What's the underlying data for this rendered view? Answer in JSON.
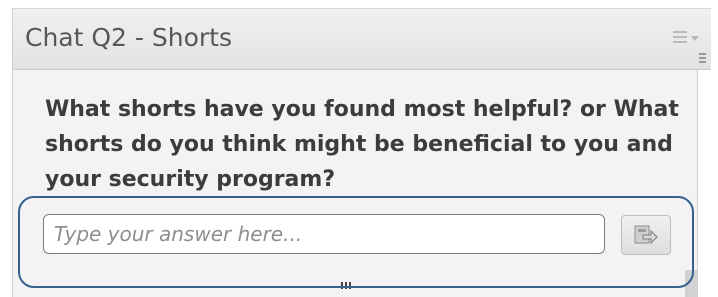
{
  "pod": {
    "title": "Chat Q2 - Shorts",
    "menu_icon": "hamburger-menu-icon",
    "question": "What shorts have you found most helpful? or What shorts do you think might be beneficial to you and your security program?",
    "answer": {
      "value": "",
      "placeholder": "Type your answer here..."
    },
    "send_icon": "send-answer-icon",
    "resize_icon": "resize-grip-icon"
  },
  "annotation": {
    "color": "#35618f"
  },
  "colors": {
    "title_text": "#575757",
    "question_text": "#3c3c3c",
    "placeholder_text": "#8e8e8e",
    "pod_background": "#f2f2f2"
  }
}
